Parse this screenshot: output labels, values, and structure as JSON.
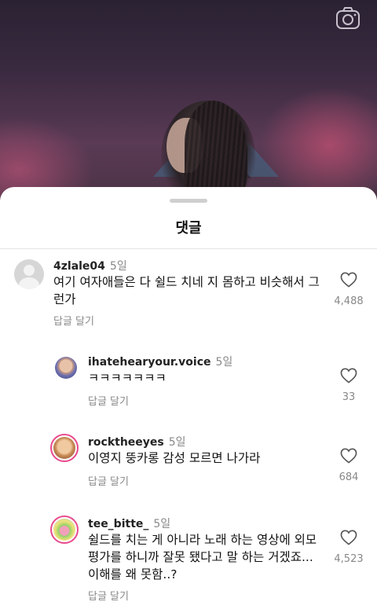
{
  "sheet": {
    "title": "댓글"
  },
  "comments": [
    {
      "username": "4zlale04",
      "time": "5일",
      "text": "여기 여자애들은 다 쉴드 치네 지 몸하고 비슷해서 그런가",
      "reply_label": "답글 달기",
      "likes": "4,488",
      "avatar": "default-avatar"
    },
    {
      "username": "ihatehearyour.voice",
      "time": "5일",
      "text": "ㅋㅋㅋㅋㅋㅋㅋ",
      "reply_label": "답글 달기",
      "likes": "33",
      "avatar": "photo-avatar"
    },
    {
      "username": "rocktheeyes",
      "time": "5일",
      "text": "이영지 뚱카롱 감성 모르면 나가라",
      "reply_label": "답글 달기",
      "likes": "684",
      "avatar": "photo-avatar-story-ring"
    },
    {
      "username": "tee_bitte_",
      "time": "5일",
      "text": "쉴드를 치는 게 아니라 노래 하는 영상에 외모 평가를 하니까 잘못 됐다고 말 하는 거겠죠... 이해를 왜 못함..?",
      "reply_label": "답글 달기",
      "likes": "4,523",
      "avatar": "cartoon-avatar-story-ring"
    }
  ],
  "colors": {
    "story_ring": "#e84a8c",
    "muted": "#888888",
    "background_sheet": "#ffffff"
  }
}
